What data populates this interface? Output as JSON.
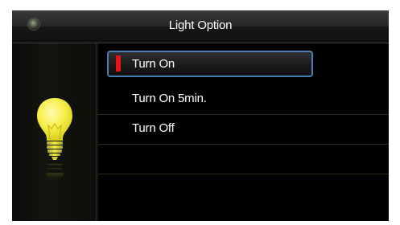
{
  "window": {
    "title": "Light Option"
  },
  "status": {
    "indicator_icon": "status-led-icon"
  },
  "illustration": {
    "icon": "light-bulb-icon",
    "glow_color": "#fbf15a"
  },
  "menu": {
    "items": [
      {
        "label": "Turn On",
        "selected": true
      },
      {
        "label": "Turn On 5min.",
        "selected": false
      },
      {
        "label": "Turn Off",
        "selected": false
      }
    ]
  },
  "colors": {
    "selection_marker": "#e8121b",
    "selection_border": "#4a7eb6",
    "background": "#000000"
  }
}
